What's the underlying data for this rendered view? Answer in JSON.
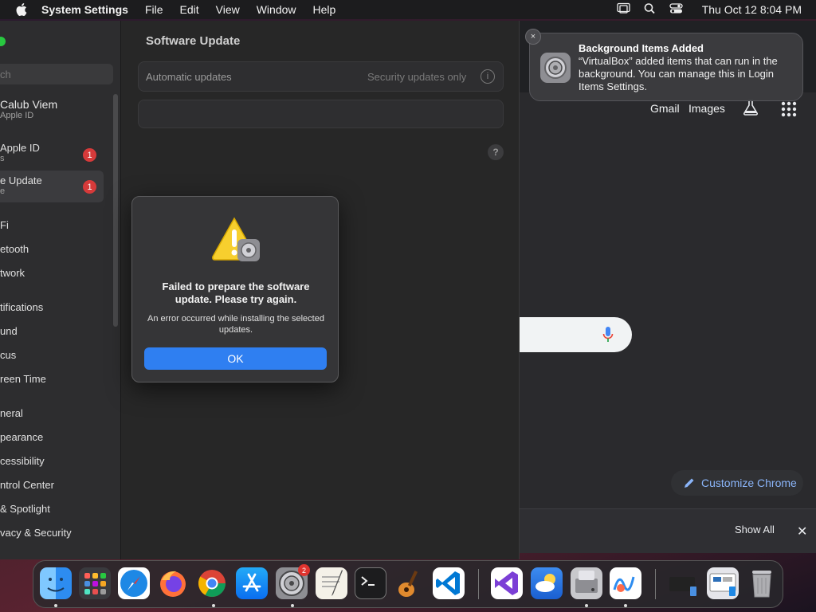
{
  "menubar": {
    "app_name": "System Settings",
    "menus": [
      "File",
      "Edit",
      "View",
      "Window",
      "Help"
    ],
    "clock": "Thu Oct 12  8:04 PM"
  },
  "notification": {
    "title": "Background Items Added",
    "body": "“VirtualBox” added items that can run in the background. You can manage this in Login Items Settings.",
    "close_glyph": "×"
  },
  "chrome": {
    "gmail": "Gmail",
    "images": "Images",
    "customize": "Customize Chrome",
    "show_all": "Show All",
    "close_glyph": "✕"
  },
  "sidebar": {
    "search_placeholder": "ch",
    "profile_name": "Calub Viem",
    "profile_sub": "Apple ID",
    "apple_id_row": {
      "line1": "Apple ID",
      "line2": "s",
      "badge": "1"
    },
    "update_row": {
      "line1": "e Update",
      "line2": "e",
      "badge": "1"
    },
    "items": [
      "Fi",
      "etooth",
      "twork",
      "tifications",
      "und",
      "cus",
      "reen Time",
      "neral",
      "pearance",
      "cessibility",
      "ntrol Center",
      "& Spotlight",
      "vacy & Security"
    ]
  },
  "content": {
    "title": "Software Update",
    "automatic_label": "Automatic updates",
    "automatic_value": "Security updates only",
    "info_glyph": "i",
    "help_glyph": "?"
  },
  "alert": {
    "title": "Failed to prepare the software update. Please try again.",
    "message": "An error occurred while installing the selected updates.",
    "ok": "OK"
  },
  "dock": {
    "apps": [
      "finder-icon",
      "launchpad-icon",
      "safari-icon",
      "firefox-icon",
      "chrome-icon",
      "app-store-icon",
      "system-settings-icon",
      "textedit-icon",
      "terminal-icon",
      "garageband-icon",
      "vscode-icon",
      "visual-studio-icon",
      "weather-icon",
      "disk-utility-icon",
      "freeform-icon",
      "downloads-folder-icon",
      "virtualbox-icon",
      "trash-icon"
    ],
    "settings_badge": "2"
  }
}
